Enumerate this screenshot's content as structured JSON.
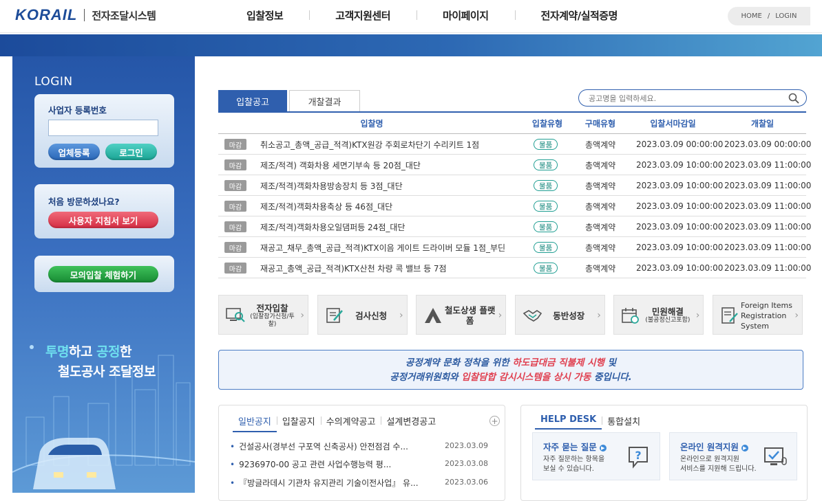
{
  "header": {
    "logo": "KORAIL",
    "system_name": "전자조달시스템",
    "nav": [
      "입찰정보",
      "고객지원센터",
      "마이페이지",
      "전자계약/실적증명"
    ],
    "util": {
      "home": "HOME",
      "sep": "/",
      "login": "LOGIN"
    }
  },
  "sidebar": {
    "title": "LOGIN",
    "reg_label": "사업자 등록번호",
    "reg_value": "",
    "register_button": "업체등록",
    "login_button": "로그인",
    "first_visit": "처음 방문하셨나요?",
    "guide_button": "사용자 지침서 보기",
    "mock_button": "모의입찰 체험하기",
    "slogan_line1_hl1": "투명",
    "slogan_line1_a": "하고 ",
    "slogan_line1_hl2": "공정",
    "slogan_line1_b": "한",
    "slogan_line2": "철도공사 조달정보"
  },
  "bid": {
    "tabs": [
      "입찰공고",
      "개찰결과"
    ],
    "search_placeholder": "공고명을 입력하세요.",
    "headers": [
      "입찰명",
      "입찰유형",
      "구매유형",
      "입찰서마감일",
      "개찰일"
    ],
    "rows": [
      {
        "status": "마감",
        "name": "취소공고_총액_공급_적격)KTX원강 주회로차단기 수리키트 1점",
        "type": "물품",
        "purchase": "총액계약",
        "deadline": "2023.03.09 00:00:00",
        "open": "2023.03.09 00:00:00"
      },
      {
        "status": "마감",
        "name": "제조/적격) 객화차용 세면기부속 등 20점_대단",
        "type": "물품",
        "purchase": "총액계약",
        "deadline": "2023.03.09 10:00:00",
        "open": "2023.03.09 11:00:00"
      },
      {
        "status": "마감",
        "name": "제조/적격)객화차용방송장치 등 3점_대단",
        "type": "물품",
        "purchase": "총액계약",
        "deadline": "2023.03.09 10:00:00",
        "open": "2023.03.09 11:00:00"
      },
      {
        "status": "마감",
        "name": "제조/적격)객화차용축상 등 46점_대단",
        "type": "물품",
        "purchase": "총액계약",
        "deadline": "2023.03.09 10:00:00",
        "open": "2023.03.09 11:00:00"
      },
      {
        "status": "마감",
        "name": "제조/적격)객화차용오일댐퍼등 24점_대단",
        "type": "물품",
        "purchase": "총액계약",
        "deadline": "2023.03.09 10:00:00",
        "open": "2023.03.09 11:00:00"
      },
      {
        "status": "마감",
        "name": "재공고_채무_총액_공급_적격)KTX이음 게이트 드라이버 모듈 1점_부딘",
        "type": "물품",
        "purchase": "총액계약",
        "deadline": "2023.03.09 10:00:00",
        "open": "2023.03.09 11:00:00"
      },
      {
        "status": "마감",
        "name": "재공고_총액_공급_적격)KTX산천 차량 콕 밸브 등 7점",
        "type": "물품",
        "purchase": "총액계약",
        "deadline": "2023.03.09 10:00:00",
        "open": "2023.03.09 11:00:00"
      }
    ]
  },
  "quick": [
    {
      "label": "전자입찰",
      "sub": "(입찰참가신청/투찰)",
      "icon": "e-bid-icon"
    },
    {
      "label": "검사신청",
      "sub": "",
      "icon": "inspection-icon"
    },
    {
      "label": "철도상생 플랫폼",
      "sub": "",
      "icon": "platform-icon"
    },
    {
      "label": "동반성장",
      "sub": "",
      "icon": "handshake-icon"
    },
    {
      "label": "민원해결",
      "sub": "(불공정신고포함)",
      "icon": "calendar-icon"
    },
    {
      "label": "Foreign Items Registration System",
      "sub": "",
      "icon": "document-icon"
    }
  ],
  "notice": {
    "l1_a": "공정계약 문화 정착을 위한 ",
    "l1_red": "하도급대금 직불제 시행",
    "l1_b": " 및",
    "l2_a": "공정거래위원회와 ",
    "l2_red": "입찰담합 감시시스템을 상시 가동",
    "l2_b": " 중입니다."
  },
  "board": {
    "tabs": [
      "일반공지",
      "입찰공지",
      "수의계약공고",
      "설계변경공고"
    ],
    "items": [
      {
        "title": "건설공사(경부선 구포역 신축공사) 안전점검 수...",
        "date": "2023.03.09"
      },
      {
        "title": "9236970-00 공고 관련 사업수행능력 평...",
        "date": "2023.03.08"
      },
      {
        "title": "『방글라데시 기관차 유지관리 기술이전사업』 유...",
        "date": "2023.03.06"
      }
    ]
  },
  "helpdesk": {
    "tabs": [
      "HELP DESK",
      "통합설치"
    ],
    "faq_title": "자주 묻는 질문",
    "faq_desc1": "자주 질문하는 항목을",
    "faq_desc2": "보실 수 있습니다.",
    "remote_title": "온라인 원격지원",
    "remote_desc1": "온라인으로 원격지원",
    "remote_desc2": "서비스를 지원해 드립니다."
  },
  "colors": {
    "primary": "#2f5fae",
    "teal": "#1f9e92",
    "red": "#e04050"
  }
}
